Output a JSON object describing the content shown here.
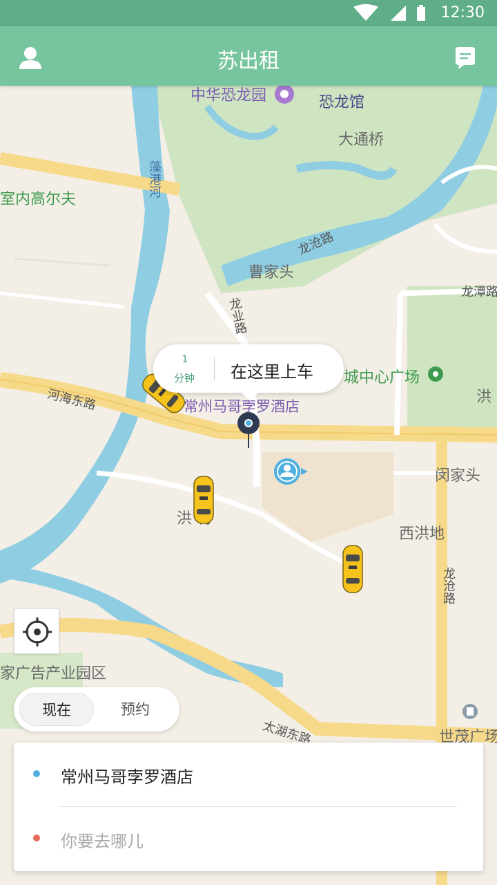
{
  "status_bar": {
    "time": "12:30"
  },
  "app_bar": {
    "title": "苏出租"
  },
  "map": {
    "labels": {
      "dinosaur_park": "中华恐龙园",
      "dinosaur_hall": "恐龙馆",
      "datong_bridge": "大通桥",
      "zaogang_river": "藻港河",
      "indoor_golf": "室内高尔夫",
      "longcang_road": "龙沧路",
      "caojiatou": "曹家头",
      "longtan_road": "龙潭路",
      "longye_road": "龙业路",
      "city_center_plaza": "城中心广场",
      "hong_east": "洪",
      "hehai_east_road": "河海东路",
      "hotel_marker": "常州马哥孛罗酒店",
      "minjiatou": "闵家头",
      "hongcun": "洪 村",
      "xihongdi": "西洪地",
      "longcang_road_v": "龙沧路",
      "ad_park": "家广告产业园区",
      "taihu_east_road": "太湖东路",
      "shimao_plaza": "世茂广场"
    }
  },
  "pickup_bubble": {
    "eta_value": "1",
    "eta_unit": "分钟",
    "text": "在这里上车"
  },
  "mode_toggle": {
    "now": "现在",
    "reserve": "预约"
  },
  "route": {
    "from": "常州马哥孛罗酒店",
    "to_placeholder": "你要去哪儿"
  },
  "colors": {
    "app_bar": "#77c59f",
    "status_bar": "#5fae89",
    "park": "#cfe5c1",
    "water": "#8fcde3",
    "road": "#f7d98a",
    "taxi": "#f6c21c"
  }
}
